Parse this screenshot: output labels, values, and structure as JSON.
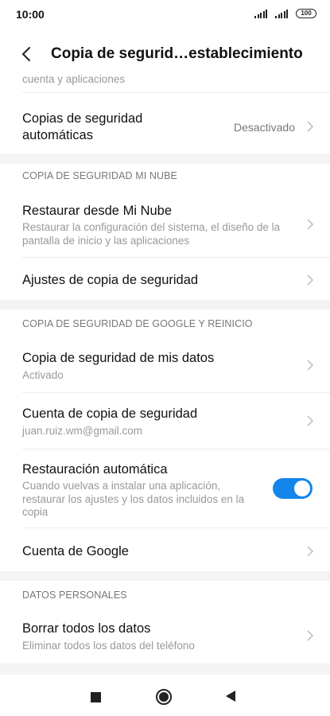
{
  "status_bar": {
    "time": "10:00",
    "battery": "100"
  },
  "header": {
    "title": "Copia de segurid…establecimiento"
  },
  "top_item": {
    "subtitle": "cuenta y aplicaciones"
  },
  "auto_backup": {
    "title_line1": "Copias de seguridad",
    "title_line2": "automáticas",
    "value": "Desactivado"
  },
  "section_mi_cloud": {
    "header": "COPIA DE SEGURIDAD MI NUBE",
    "restore": {
      "title": "Restaurar desde Mi Nube",
      "subtitle_line1": "Restaurar la configuración del sistema, el diseño de la",
      "subtitle_line2": "pantalla de inicio y las aplicaciones"
    },
    "backup_settings": {
      "title": "Ajustes de copia de seguridad"
    }
  },
  "section_google": {
    "header": "COPIA DE SEGURIDAD DE GOOGLE Y REINICIO",
    "backup_data": {
      "title": "Copia de seguridad de mis datos",
      "subtitle": "Activado"
    },
    "backup_account": {
      "title": "Cuenta de copia de seguridad",
      "subtitle": "juan.ruiz.wm@gmail.com"
    },
    "auto_restore": {
      "title": "Restauración automática",
      "subtitle_line1": "Cuando vuelvas a instalar una aplicación,",
      "subtitle_line2": "restaurar los ajustes y los datos incluidos en la",
      "subtitle_line3": "copia",
      "enabled": true
    },
    "google_account": {
      "title": "Cuenta de Google"
    }
  },
  "section_personal": {
    "header": "DATOS PERSONALES",
    "erase": {
      "title": "Borrar todos los datos",
      "subtitle": "Eliminar todos los datos del teléfono"
    }
  },
  "colors": {
    "accent": "#1486ea",
    "section_bg": "#f4f4f4"
  },
  "nav_icons": [
    "recents-icon",
    "home-icon",
    "back-icon"
  ]
}
